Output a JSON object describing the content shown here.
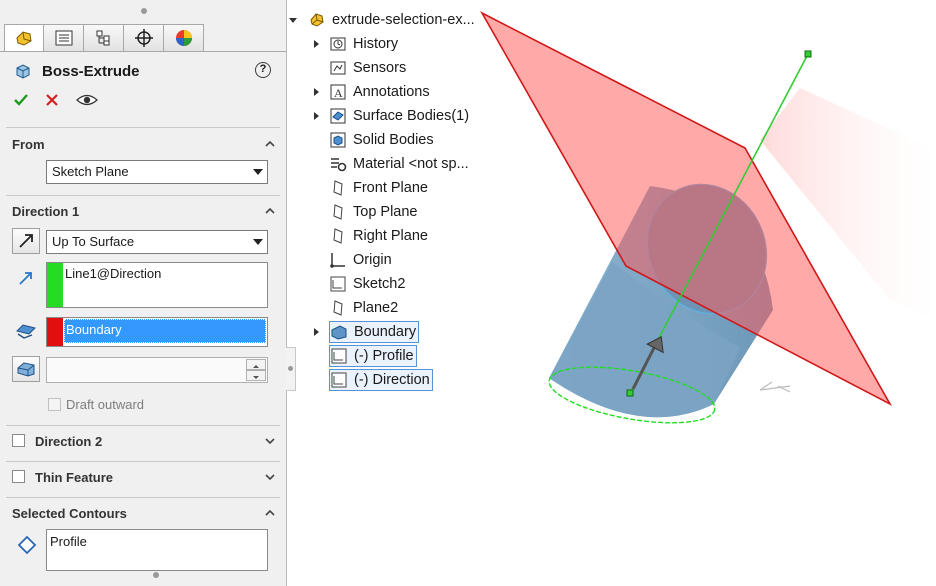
{
  "tabs": [
    {
      "icon": "feature-manager-icon",
      "active": true
    },
    {
      "icon": "property-manager-icon",
      "active": false
    },
    {
      "icon": "configuration-manager-icon",
      "active": false
    },
    {
      "icon": "dimxpert-icon",
      "active": false
    },
    {
      "icon": "display-manager-icon",
      "active": false
    }
  ],
  "pm": {
    "title": "Boss-Extrude",
    "help": "?",
    "ok_icon": "checkmark-icon",
    "cancel_icon": "close-icon",
    "preview_icon": "eye-icon"
  },
  "from": {
    "title": "From",
    "value": "Sketch Plane"
  },
  "direction1": {
    "title": "Direction 1",
    "end_condition": "Up To Surface",
    "direction_ref": "Line1@Direction",
    "direction_color": "#22dd22",
    "face_ref": "Boundary",
    "face_color": "#e01010",
    "offset_value": "",
    "draft_label": "Draft outward"
  },
  "direction2": {
    "title": "Direction 2",
    "checked": false
  },
  "thin": {
    "title": "Thin Feature",
    "checked": false
  },
  "contours": {
    "title": "Selected Contours",
    "items": [
      "Profile"
    ]
  },
  "tree": {
    "root": "extrude-selection-ex...",
    "items": [
      {
        "label": "History",
        "icon": "history-icon",
        "expandable": true
      },
      {
        "label": "Sensors",
        "icon": "sensors-icon",
        "expandable": false
      },
      {
        "label": "Annotations",
        "icon": "annotations-icon",
        "expandable": true
      },
      {
        "label": "Surface Bodies(1)",
        "icon": "surface-bodies-icon",
        "expandable": true
      },
      {
        "label": "Solid Bodies",
        "icon": "solid-bodies-icon",
        "expandable": false
      },
      {
        "label": "Material <not sp...",
        "icon": "material-icon",
        "expandable": false
      },
      {
        "label": "Front Plane",
        "icon": "plane-icon",
        "expandable": false
      },
      {
        "label": "Top Plane",
        "icon": "plane-icon",
        "expandable": false
      },
      {
        "label": "Right Plane",
        "icon": "plane-icon",
        "expandable": false
      },
      {
        "label": "Origin",
        "icon": "origin-icon",
        "expandable": false
      },
      {
        "label": "Sketch2",
        "icon": "sketch-icon",
        "expandable": false
      },
      {
        "label": "Plane2",
        "icon": "plane-icon",
        "expandable": false
      },
      {
        "label": "Boundary",
        "icon": "boundary-surface-icon",
        "expandable": true,
        "highlighted": true
      },
      {
        "label": "(-) Profile",
        "icon": "sketch-icon",
        "expandable": false,
        "highlighted": true
      },
      {
        "label": "(-) Direction",
        "icon": "sketch-icon",
        "expandable": false,
        "highlighted": true
      }
    ]
  },
  "colors": {
    "plane_fill": "#ff5a5a",
    "plane_edge": "#d01818",
    "cylinder": "#7aa3c4",
    "line": "#33cc33",
    "selection": "#3399ff"
  }
}
